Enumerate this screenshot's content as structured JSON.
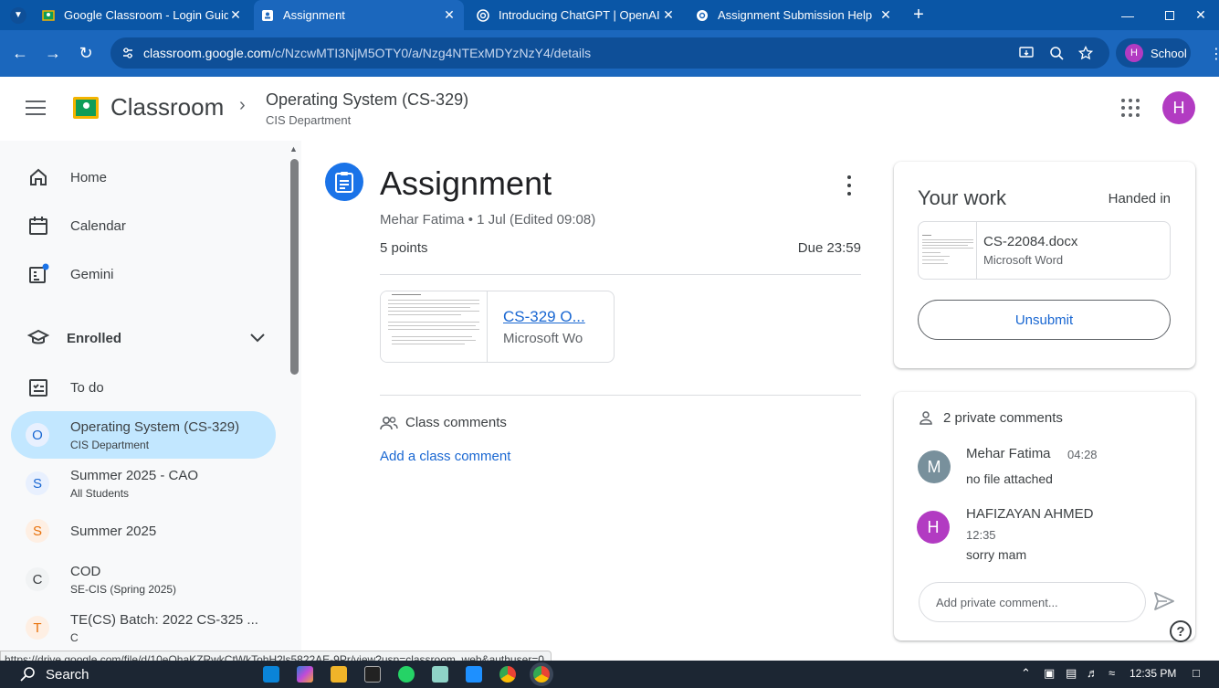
{
  "browser": {
    "tabs": [
      {
        "title": "Google Classroom - Login Guid",
        "icon": "classroom-icon",
        "active": false
      },
      {
        "title": "Assignment",
        "icon": "classroom-icon",
        "active": true
      },
      {
        "title": "Introducing ChatGPT | OpenAI",
        "icon": "openai-icon",
        "active": false
      },
      {
        "title": "Assignment Submission Help",
        "icon": "openai-icon",
        "active": false
      }
    ],
    "url_domain": "classroom.google.com",
    "url_path": "/c/NzcwMTI3NjM5OTY0/a/Nzg4NTExMDYzNzY4/details",
    "profile_initial": "H",
    "profile_label": "School"
  },
  "header": {
    "app_name": "Classroom",
    "course_title": "Operating System (CS-329)",
    "course_subtitle": "CIS Department",
    "avatar_initial": "H"
  },
  "sidebar": {
    "nav": [
      {
        "label": "Home",
        "icon": "home-icon"
      },
      {
        "label": "Calendar",
        "icon": "calendar-icon"
      },
      {
        "label": "Gemini",
        "icon": "gemini-icon"
      }
    ],
    "enrolled_label": "Enrolled",
    "todo_label": "To do",
    "courses": [
      {
        "letter": "O",
        "name": "Operating System (CS-329)",
        "sub": "CIS Department",
        "color": "#1967d2",
        "selected": true
      },
      {
        "letter": "S",
        "name": "Summer 2025 - CAO",
        "sub": "All Students",
        "color": "#1967d2"
      },
      {
        "letter": "S",
        "name": "Summer 2025",
        "sub": "",
        "color": "#e8710a"
      },
      {
        "letter": "C",
        "name": "COD",
        "sub": "SE-CIS (Spring 2025)",
        "color": "#3c4043"
      },
      {
        "letter": "T",
        "name": "TE(CS) Batch: 2022 CS-325 ...",
        "sub": "C",
        "color": "#e8710a"
      }
    ]
  },
  "assignment": {
    "title": "Assignment",
    "meta": "Mehar Fatima • 1 Jul (Edited 09:08)",
    "points": "5 points",
    "due": "Due 23:59",
    "attachment_title": "CS-329 O...",
    "attachment_type": "Microsoft Wo",
    "class_comments_label": "Class comments",
    "add_class_comment": "Add a class comment"
  },
  "your_work": {
    "title": "Your work",
    "status": "Handed in",
    "file_name": "CS-22084.docx",
    "file_type": "Microsoft Word",
    "unsubmit_label": "Unsubmit"
  },
  "private_comments": {
    "title": "2 private comments",
    "comments": [
      {
        "initial": "M",
        "author": "Mehar Fatima",
        "time": "04:28",
        "text": "no file attached",
        "color": "#78909c"
      },
      {
        "initial": "H",
        "author": "HAFIZAYAN AHMED",
        "time": "12:35",
        "text": "sorry mam",
        "color": "#b23bc2"
      }
    ],
    "input_placeholder": "Add private comment..."
  },
  "status_link": "https://drive.google.com/file/d/10eOhaKZRwkCtWkTohH2ls5822AE-9Pr/view?usp=classroom_web&authuser=0",
  "taskbar": {
    "search_label": "Search",
    "clock": "12:35 PM"
  }
}
